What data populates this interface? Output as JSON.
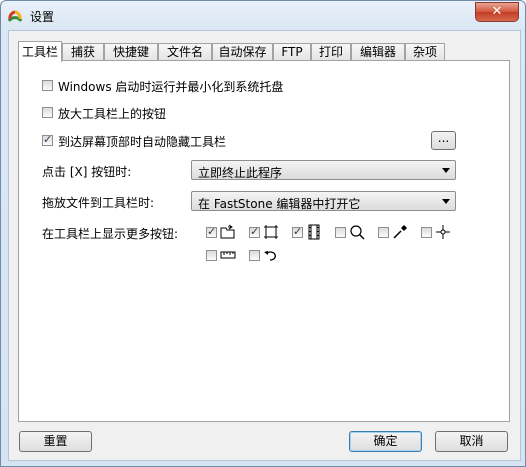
{
  "window": {
    "title": "设置",
    "close_label": "✕"
  },
  "tabs": [
    {
      "label": "工具栏",
      "active": true
    },
    {
      "label": "捕获"
    },
    {
      "label": "快捷键"
    },
    {
      "label": "文件名"
    },
    {
      "label": "自动保存"
    },
    {
      "label": "FTP"
    },
    {
      "label": "打印"
    },
    {
      "label": "编辑器"
    },
    {
      "label": "杂项"
    }
  ],
  "options": {
    "minimize_to_tray": {
      "label": "Windows 启动时运行并最小化到系统托盘",
      "checked": false
    },
    "enlarge_buttons": {
      "label": "放大工具栏上的按钮",
      "checked": false
    },
    "auto_hide": {
      "label": "到达屏幕顶部时自动隐藏工具栏",
      "checked": true,
      "button_label": "..."
    }
  },
  "close_action": {
    "label": "点击 [X] 按钮时:",
    "value": "立即终止此程序"
  },
  "drag_action": {
    "label": "拖放文件到工具栏时:",
    "value": "在 FastStone 编辑器中打开它"
  },
  "more_buttons": {
    "label": "在工具栏上显示更多按钮:",
    "items": [
      {
        "icon": "open-folder-icon",
        "checked": true
      },
      {
        "icon": "crop-rectangle-icon",
        "checked": true
      },
      {
        "icon": "film-strip-icon",
        "checked": true
      },
      {
        "icon": "magnifier-icon",
        "checked": false
      },
      {
        "icon": "color-picker-icon",
        "checked": false
      },
      {
        "icon": "crosshair-icon",
        "checked": false
      },
      {
        "icon": "ruler-icon",
        "checked": false
      },
      {
        "icon": "undo-arrow-icon",
        "checked": false
      }
    ]
  },
  "buttons": {
    "reset": "重置",
    "ok": "确定",
    "cancel": "取消"
  }
}
